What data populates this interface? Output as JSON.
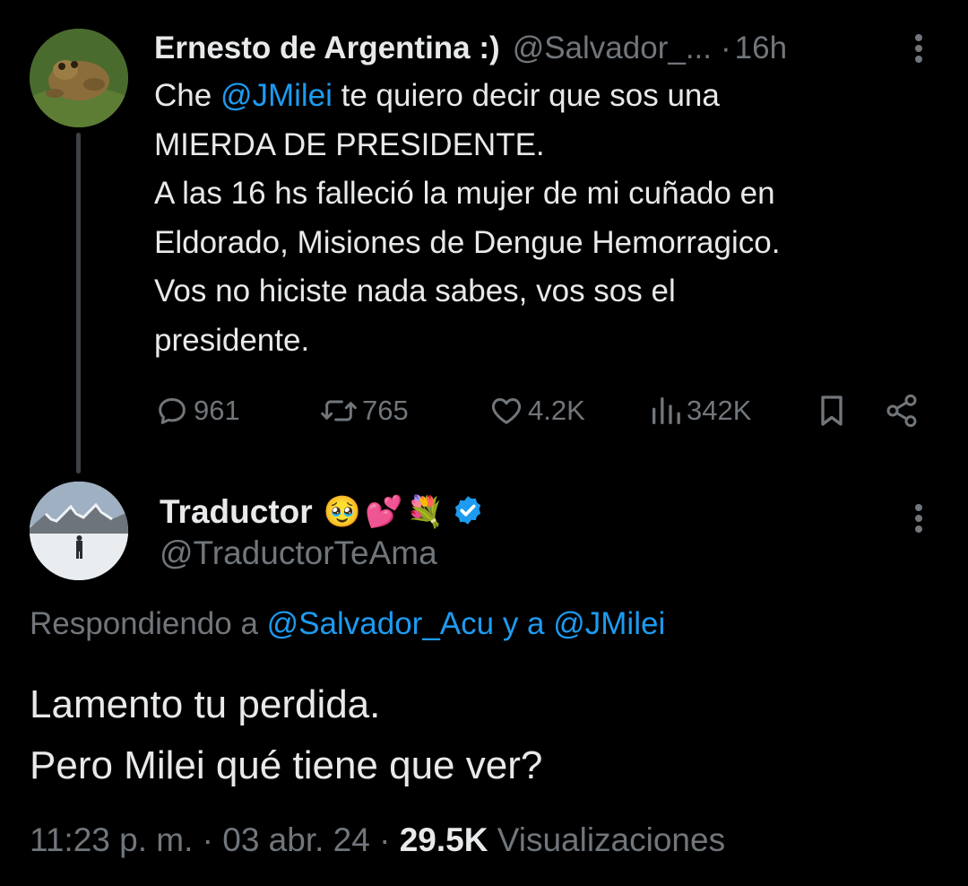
{
  "parent_tweet": {
    "author_name": "Ernesto de Argentina :)",
    "author_handle": "@Salvador_...",
    "separator": "·",
    "time": "16h",
    "body_prefix": "Che ",
    "body_mention": "@JMilei",
    "body_rest": " te quiero decir que sos una\nMIERDA DE PRESIDENTE.\nA las 16 hs falleció la mujer de mi cuñado en\nEldorado, Misiones de Dengue Hemorragico.\nVos no hiciste nada sabes, vos sos el\npresidente.",
    "actions": {
      "replies": "961",
      "reposts": "765",
      "likes": "4.2K",
      "views": "342K"
    },
    "icons": {
      "reply": "reply-icon",
      "repost": "repost-icon",
      "like": "heart-icon",
      "views": "views-chart-icon",
      "bookmark": "bookmark-icon",
      "share": "share-icon",
      "more": "more-vertical-icon"
    }
  },
  "reply_tweet": {
    "author_name": "Traductor",
    "emojis": [
      "🥹",
      "💕",
      "💐"
    ],
    "verified": true,
    "author_handle": "@TraductorTeAma",
    "replying_prefix": "Respondiendo a ",
    "replying_user1": "@Salvador_Acu",
    "replying_and": " y a ",
    "replying_user2": "@JMilei",
    "body": "Lamento tu perdida.\nPero Milei qué tiene que ver?",
    "timestamp": "11:23 p. m. · 03 abr. 24 · ",
    "view_count": "29.5K",
    "view_label": " Visualizaciones"
  },
  "colors": {
    "background": "#000000",
    "text_primary": "#e7e9ea",
    "text_secondary": "#71767b",
    "accent": "#1d9bf0",
    "thread_line": "#3d4145"
  }
}
